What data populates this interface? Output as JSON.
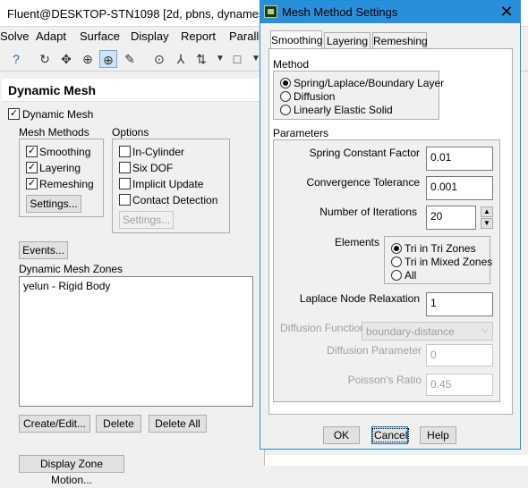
{
  "window": {
    "title": "Fluent@DESKTOP-STN1098  [2d, pbns, dynames",
    "menu": [
      "Solve",
      "Adapt",
      "Surface",
      "Display",
      "Report",
      "Paralle"
    ]
  },
  "toolbar_icons": [
    "help-icon",
    "rotate-icon",
    "translate-icon",
    "zoom-icon",
    "zoom-box-icon",
    "probe-icon",
    "fit-icon",
    "orient-icon",
    "dropdown-icon",
    "view-icon"
  ],
  "dynamic_mesh": {
    "header": "Dynamic Mesh",
    "dynamic_mesh_label": "Dynamic Mesh",
    "mesh_methods": {
      "title": "Mesh Methods",
      "items": [
        {
          "label": "Smoothing",
          "checked": true
        },
        {
          "label": "Layering",
          "checked": true
        },
        {
          "label": "Remeshing",
          "checked": true
        }
      ],
      "settings_button": "Settings..."
    },
    "options": {
      "title": "Options",
      "items": [
        {
          "label": "In-Cylinder",
          "checked": false
        },
        {
          "label": "Six DOF",
          "checked": false
        },
        {
          "label": "Implicit Update",
          "checked": false
        },
        {
          "label": "Contact Detection",
          "checked": false
        }
      ],
      "settings_button": "Settings..."
    },
    "events_button": "Events...",
    "zones_title": "Dynamic Mesh Zones",
    "zones": [
      "yelun - Rigid Body"
    ],
    "create_edit_button": "Create/Edit...",
    "delete_button": "Delete",
    "delete_all_button": "Delete All",
    "display_zone_motion_button": "Display Zone Motion..."
  },
  "dialog": {
    "title": "Mesh Method Settings",
    "tabs": [
      "Smoothing",
      "Layering",
      "Remeshing"
    ],
    "method": {
      "title": "Method",
      "options": [
        "Spring/Laplace/Boundary Layer",
        "Diffusion",
        "Linearly Elastic Solid"
      ],
      "selected": "Spring/Laplace/Boundary Layer"
    },
    "parameters": {
      "title": "Parameters",
      "spring_constant_label": "Spring Constant Factor",
      "spring_constant_value": "0.01",
      "convergence_label": "Convergence Tolerance",
      "convergence_value": "0.001",
      "iterations_label": "Number of Iterations",
      "iterations_value": "20",
      "elements_label": "Elements",
      "elements_options": [
        "Tri in Tri Zones",
        "Tri in Mixed Zones",
        "All"
      ],
      "elements_selected": "Tri in Tri Zones",
      "laplace_label": "Laplace Node Relaxation",
      "laplace_value": "1",
      "diffusion_function_label": "Diffusion Function",
      "diffusion_function_value": "boundary-distance",
      "diffusion_parameter_label": "Diffusion Parameter",
      "diffusion_parameter_value": "0",
      "poisson_label": "Poisson's Ratio",
      "poisson_value": "0.45"
    },
    "ok_button": "OK",
    "cancel_button": "Cancel",
    "help_button": "Help"
  }
}
